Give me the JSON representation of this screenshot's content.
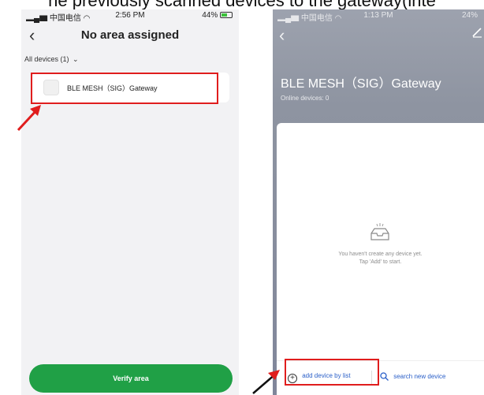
{
  "caption": "he previously scanned devices to the gateway(inte",
  "left_screen": {
    "status": {
      "carrier": "中国电信",
      "time": "2:56 PM",
      "battery": "44%"
    },
    "title": "No area assigned",
    "filter_label": "All devices (1)",
    "device_name": "BLE MESH（SIG）Gateway",
    "verify_button": "Verify area"
  },
  "right_screen": {
    "status": {
      "carrier": "中国电信",
      "time": "1:13 PM",
      "battery": "24%"
    },
    "gateway_title": "BLE MESH（SIG）Gateway",
    "online_devices": "Online devices: 0",
    "empty_line1": "You haven't create any device yet.",
    "empty_line2": "Tap 'Add' to start.",
    "add_by_list": "add device by list",
    "search_new": "search new device"
  },
  "colors": {
    "highlight": "#e01d1d",
    "primary_green": "#20a046",
    "link_blue": "#2a5fc8"
  }
}
